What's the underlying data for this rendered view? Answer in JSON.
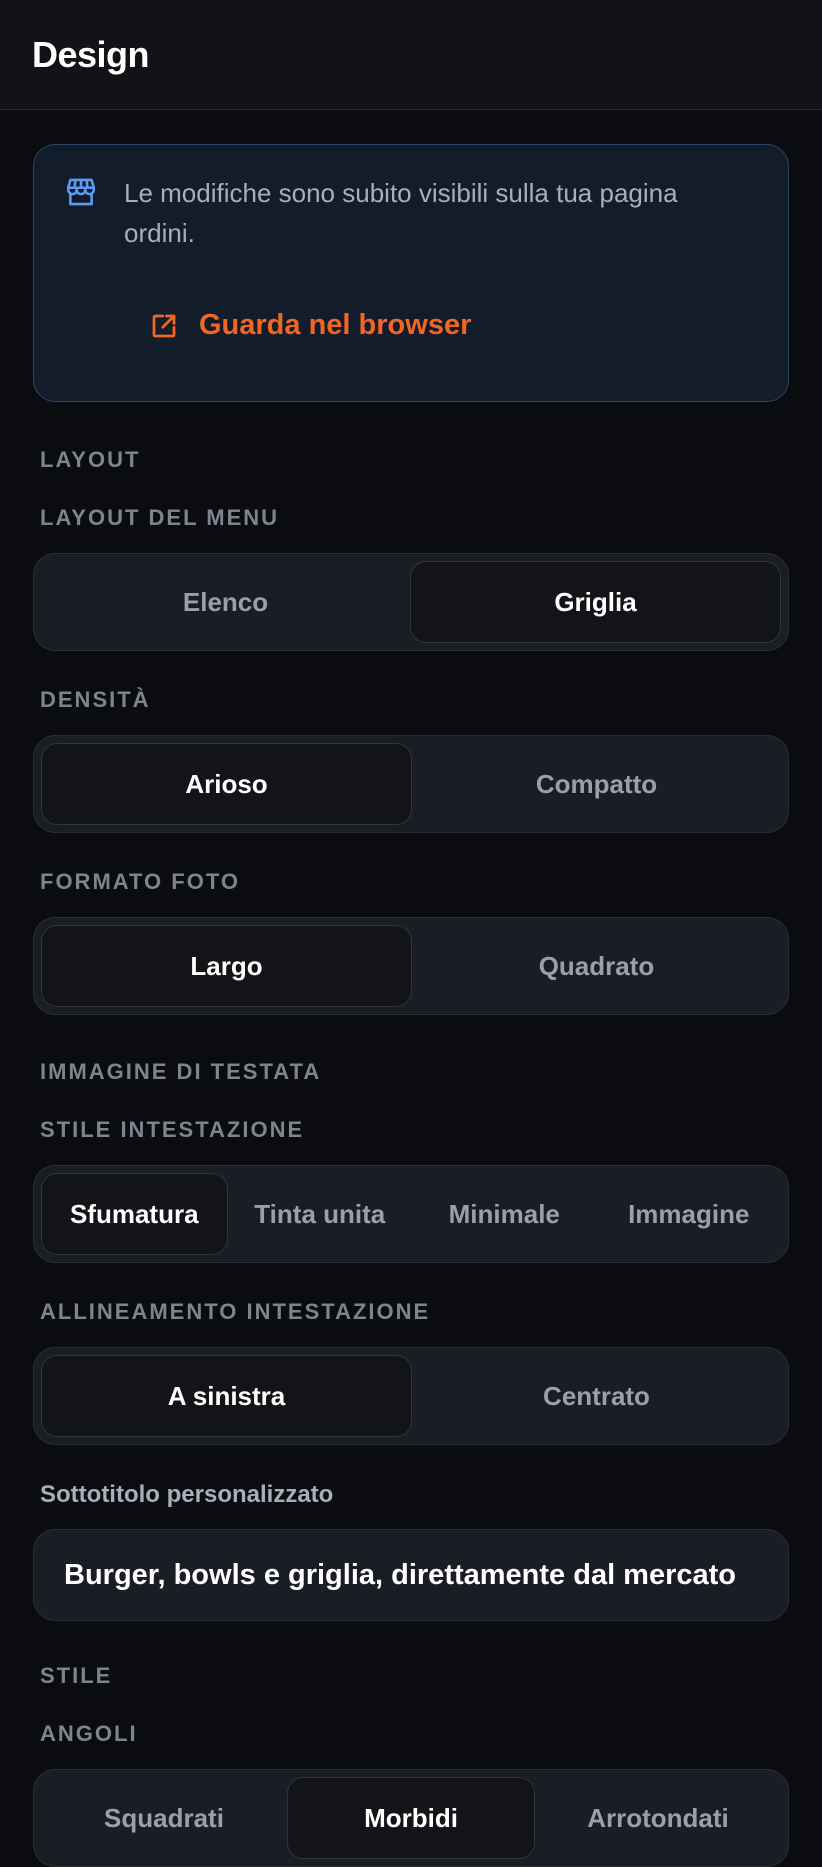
{
  "header": {
    "title": "Design"
  },
  "info": {
    "icon": "storefront-icon",
    "text": "Le modifiche sono subito visibili sulla tua pagina ordini.",
    "link_icon": "external-link-icon",
    "link_label": "Guarda nel browser",
    "accent": "#f26522",
    "icon_color": "#5b9bf2"
  },
  "layout_section": {
    "label": "LAYOUT",
    "menu_layout": {
      "label": "LAYOUT DEL MENU",
      "options": [
        "Elenco",
        "Griglia"
      ],
      "selected": "Griglia"
    },
    "density": {
      "label": "DENSITÀ",
      "options": [
        "Arioso",
        "Compatto"
      ],
      "selected": "Arioso"
    },
    "photo_format": {
      "label": "FORMATO FOTO",
      "options": [
        "Largo",
        "Quadrato"
      ],
      "selected": "Largo"
    }
  },
  "header_image_section": {
    "label": "IMMAGINE DI TESTATA",
    "header_style": {
      "label": "STILE INTESTAZIONE",
      "options": [
        "Sfumatura",
        "Tinta unita",
        "Minimale",
        "Immagine"
      ],
      "selected": "Sfumatura"
    },
    "header_alignment": {
      "label": "ALLINEAMENTO INTESTAZIONE",
      "options": [
        "A sinistra",
        "Centrato"
      ],
      "selected": "A sinistra"
    },
    "subtitle": {
      "label": "Sottotitolo personalizzato",
      "value": "Burger, bowls e griglia, direttamente dal mercato"
    }
  },
  "style_section": {
    "label": "STILE",
    "corners": {
      "label": "ANGOLI",
      "options": [
        "Squadrati",
        "Morbidi",
        "Arrotondati"
      ],
      "selected": "Morbidi"
    }
  }
}
